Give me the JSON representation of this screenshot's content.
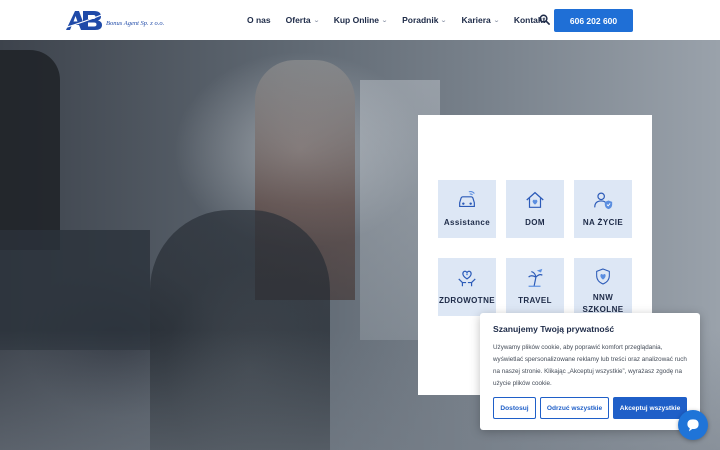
{
  "header": {
    "logo_text": "Bonus Agent Sp. z o.o.",
    "logo_letters": "AB",
    "nav": [
      {
        "label": "O nas",
        "has_dropdown": false
      },
      {
        "label": "Oferta",
        "has_dropdown": true
      },
      {
        "label": "Kup Online",
        "has_dropdown": true
      },
      {
        "label": "Poradnik",
        "has_dropdown": true
      },
      {
        "label": "Kariera",
        "has_dropdown": true
      },
      {
        "label": "Kontakt",
        "has_dropdown": false
      }
    ],
    "search_icon": "search-icon",
    "phone": "606 202 600",
    "accent": "#1f6fd6"
  },
  "products": [
    {
      "label": "Assistance",
      "icon": "car-icon"
    },
    {
      "label": "DOM",
      "icon": "house-icon"
    },
    {
      "label": "NA ŻYCIE",
      "icon": "person-shield-icon"
    },
    {
      "label": "ZDROWOTNE",
      "icon": "heart-hands-icon"
    },
    {
      "label": "TRAVEL",
      "icon": "plane-palm-icon"
    },
    {
      "label": "NNW SZKOLNE",
      "icon": "shield-heart-icon"
    }
  ],
  "cookie": {
    "title": "Szanujemy Twoją prywatność",
    "text": "Używamy plików cookie, aby poprawić komfort przeglądania, wyświetlać spersonalizowane reklamy lub treści oraz analizować ruch na naszej stronie. Klikając „Akceptuj wszystkie”, wyrażasz zgodę na użycie plików cookie.",
    "btn_customize": "Dostosuj",
    "btn_reject": "Odrzuć wszystkie",
    "btn_accept": "Akceptuj wszystkie"
  },
  "chat_icon": "chat-bubble-icon"
}
